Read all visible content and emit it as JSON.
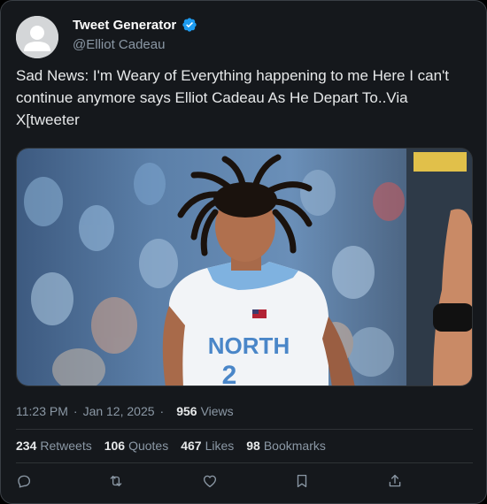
{
  "author": {
    "display_name": "Tweet Generator",
    "handle": "@Elliot Cadeau",
    "verified": true,
    "verified_color": "#1d9bf0"
  },
  "tweet": {
    "text": "Sad News: I'm Weary of Everything happening to me Here I can't continue anymore says Elliot Cadeau As He Depart To..Via X[tweeter",
    "media": {
      "jersey_text": "NORTH",
      "jersey_number": "2"
    }
  },
  "meta": {
    "time": "11:23 PM",
    "date": "Jan 12, 2025",
    "separator": "·",
    "date_prefix": "· ",
    "views_count": "956",
    "views_label": "Views"
  },
  "stats": {
    "retweets_count": "234",
    "retweets_label": "Retweets",
    "quotes_count": "106",
    "quotes_label": "Quotes",
    "likes_count": "467",
    "likes_label": "Likes",
    "bookmarks_count": "98",
    "bookmarks_label": "Bookmarks"
  },
  "actions": [
    "reply-icon",
    "retweet-icon",
    "like-icon",
    "bookmark-icon",
    "share-icon"
  ],
  "colors": {
    "background": "#15181c",
    "text": "#e7e9ea",
    "secondary": "#8b98a5",
    "border": "#2f3336"
  }
}
